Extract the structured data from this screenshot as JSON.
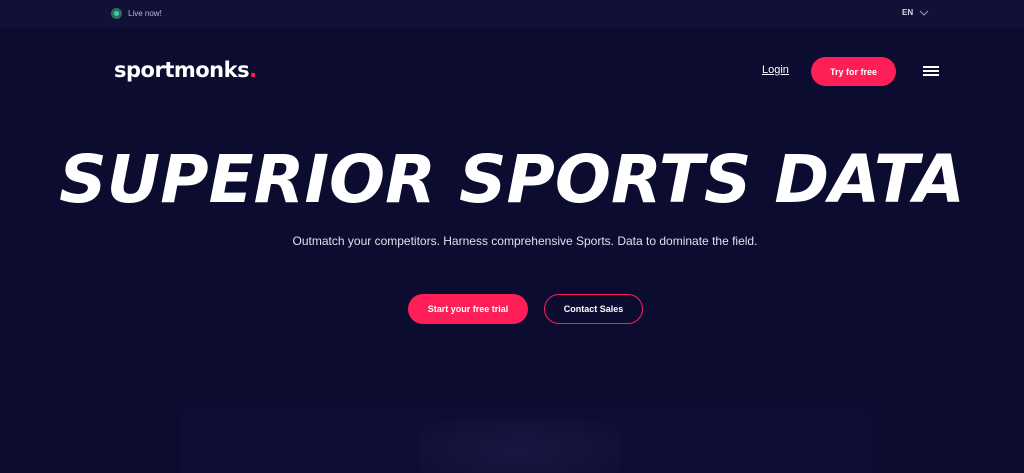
{
  "topbar": {
    "live_label": "Live now!",
    "language": "EN"
  },
  "nav": {
    "brand": "sportmonks",
    "brand_dot": ".",
    "login_label": "Login",
    "try_label": "Try for free"
  },
  "hero": {
    "title": "SUPERIOR SPORTS DATA",
    "subtitle": "Outmatch your competitors. Harness comprehensive Sports. Data to dominate the field.",
    "primary_cta": "Start your free trial",
    "secondary_cta": "Contact Sales"
  },
  "colors": {
    "background": "#0c0c31",
    "accent": "#ff1e56",
    "live_indicator": "#3fd1a4"
  },
  "icons": [
    "live-status-icon",
    "chevron-down-icon",
    "hamburger-menu-icon"
  ]
}
